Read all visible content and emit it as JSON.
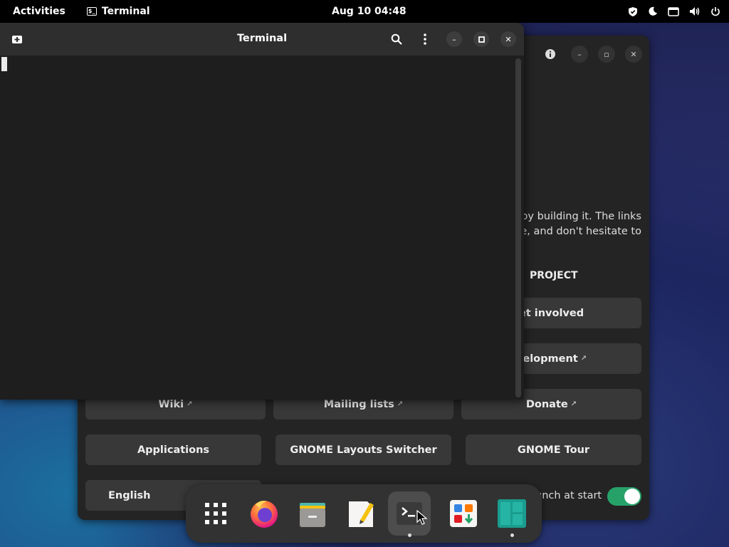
{
  "topbar": {
    "activities": "Activities",
    "app_name": "Terminal",
    "clock": "Aug 10  04:48",
    "tray_icons": [
      "shield-icon",
      "night-light-icon",
      "screen-icon",
      "volume-icon",
      "power-icon"
    ]
  },
  "terminal": {
    "title": "Terminal",
    "icons": [
      "new-tab-icon",
      "search-icon",
      "menu-icon",
      "minimize-icon",
      "maximize-icon",
      "close-icon"
    ]
  },
  "welcome": {
    "paragraph_line1": "oy building it. The links",
    "paragraph_line2": "e, and don't hesitate to",
    "section_heading": "PROJECT",
    "buttons": {
      "get_involved": "et involved",
      "development": "velopment",
      "wiki": "Wiki",
      "mailing_lists": "Mailing lists",
      "donate": "Donate",
      "applications": "Applications",
      "layouts_switcher": "GNOME Layouts Switcher",
      "tour": "GNOME Tour",
      "language": "English"
    },
    "launch_label": "unch at start",
    "launch_toggle_on": true
  },
  "dock": {
    "items": [
      "app-grid",
      "firefox",
      "files",
      "text-editor",
      "terminal",
      "software",
      "manjaro-hello"
    ],
    "active": "terminal"
  },
  "colors": {
    "accent_green": "#26a269",
    "firefox_orange": "#ff7139",
    "manjaro_green": "#35bf5c"
  }
}
